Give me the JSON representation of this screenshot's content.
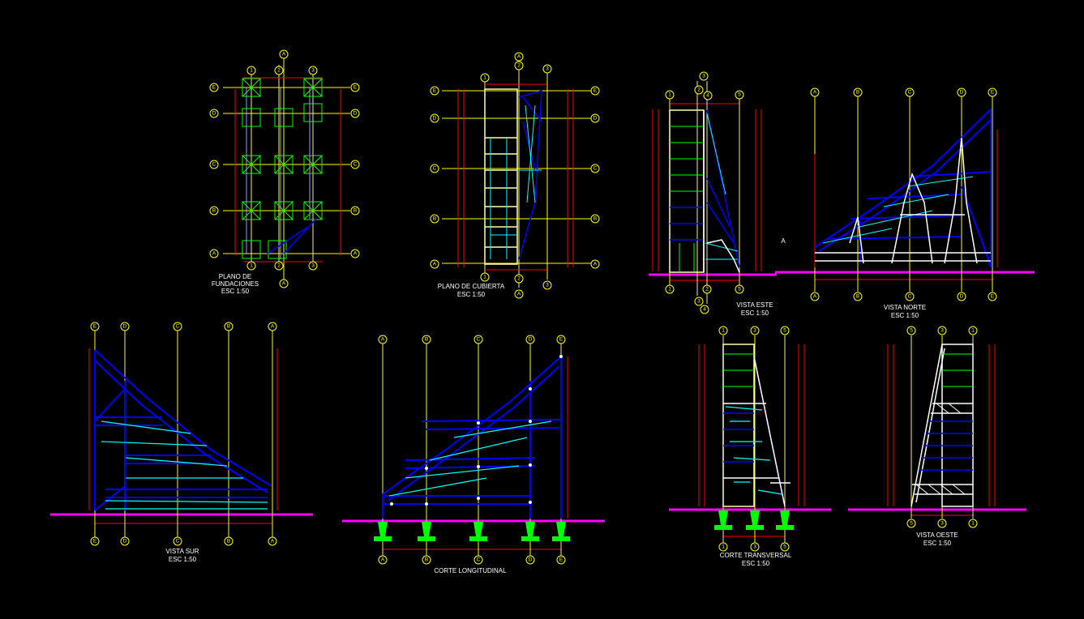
{
  "colors": {
    "background": "#000000",
    "axis": "#ffff00",
    "dimension": "#ff0000",
    "truss": "#0000ff",
    "bracing": "#00ffff",
    "column": "#ffffff",
    "footing": "#00ff00",
    "ground": "#ff00ff"
  },
  "drawings": {
    "plano_fundaciones": {
      "title": "PLANO DE",
      "title2": "FUNDACIONES",
      "scale": "ESC 1:50"
    },
    "plano_cubierta": {
      "title": "PLANO DE CUBIERTA",
      "scale": "ESC 1:50"
    },
    "vista_este": {
      "title": "VISTA ESTE",
      "scale": "ESC 1:50"
    },
    "vista_norte": {
      "title": "VISTA NORTE",
      "scale": "ESC 1:50"
    },
    "vista_sur": {
      "title": "VISTA SUR",
      "scale": "ESC 1:50"
    },
    "corte_longitudinal": {
      "title": "CORTE LONGITUDINAL"
    },
    "corte_transversal": {
      "title": "CORTE TRANSVERSAL",
      "scale": "ESC 1:50"
    },
    "vista_oeste": {
      "title": "VISTA OESTE",
      "scale": "ESC 1:50"
    }
  },
  "markers": {
    "stray_letter": "A"
  },
  "grid_axes": {
    "plan_rows": [
      "E",
      "D",
      "C",
      "B",
      "A"
    ],
    "plan_cols": [
      "1",
      "2",
      "3"
    ],
    "plan_center": "A",
    "este_cols": [
      "1",
      "3",
      "2",
      "4",
      "5"
    ],
    "norte_cols": [
      "A",
      "B",
      "C",
      "D",
      "E"
    ],
    "sur_cols": [
      "E",
      "D",
      "C",
      "B",
      "A"
    ],
    "longitudinal_cols": [
      "A",
      "B",
      "C",
      "D",
      "E"
    ],
    "transversal_cols": [
      "1",
      "3",
      "5"
    ],
    "oeste_cols": [
      "5",
      "3",
      "1"
    ]
  }
}
